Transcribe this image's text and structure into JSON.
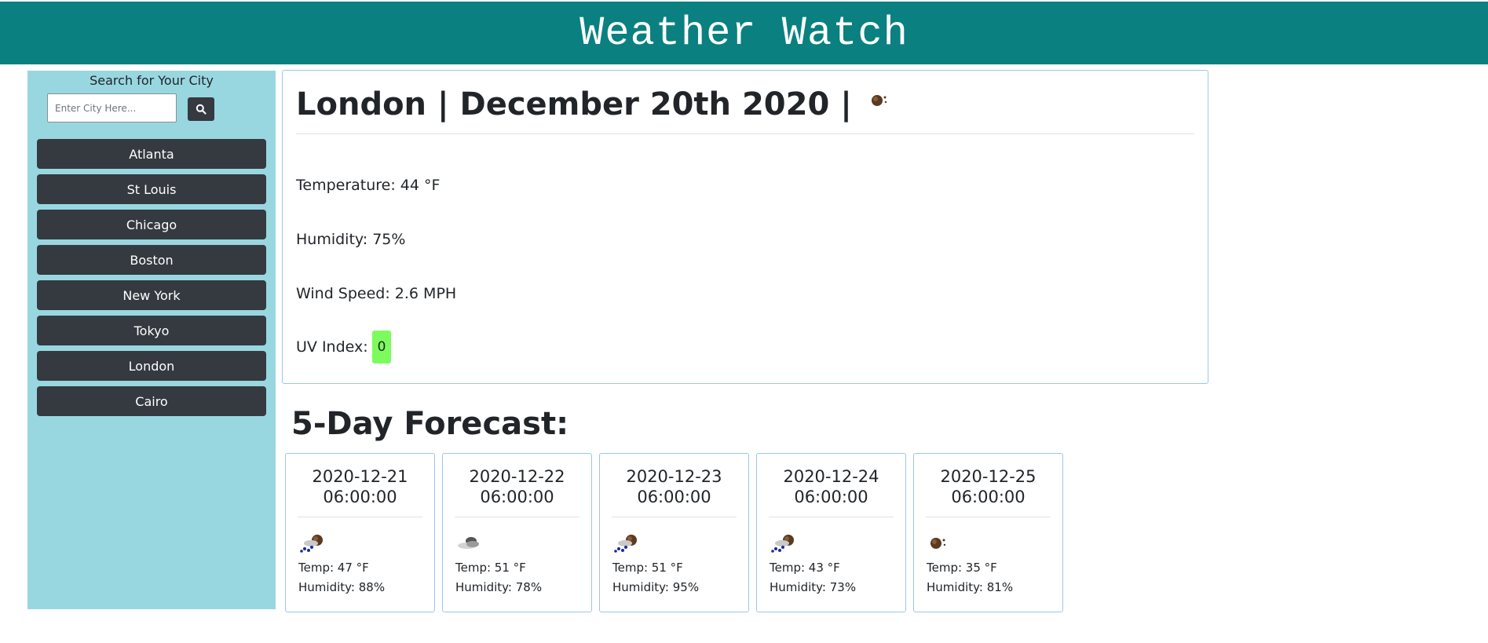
{
  "header": {
    "title": "Weather Watch"
  },
  "sidebar": {
    "search_label": "Search for Your City",
    "search_placeholder": "Enter City Here...",
    "cities": [
      "Atlanta",
      "St Louis",
      "Chicago",
      "Boston",
      "New York",
      "Tokyo",
      "London",
      "Cairo"
    ]
  },
  "current": {
    "title": "London | December 20th 2020 |",
    "icon": "clear-night-icon",
    "temperature": "Temperature: 44 °F",
    "humidity": "Humidity: 75%",
    "wind": "Wind Speed: 2.6 MPH",
    "uv_label": "UV Index:",
    "uv_value": "0",
    "uv_color": "#7cfc5c"
  },
  "forecast": {
    "title": "5-Day Forecast:",
    "days": [
      {
        "date": "2020-12-21",
        "time": "06:00:00",
        "icon": "rain-night-icon",
        "temp": "Temp: 47 °F",
        "humidity": "Humidity: 88%"
      },
      {
        "date": "2020-12-22",
        "time": "06:00:00",
        "icon": "cloud-icon",
        "temp": "Temp: 51 °F",
        "humidity": "Humidity: 78%"
      },
      {
        "date": "2020-12-23",
        "time": "06:00:00",
        "icon": "rain-night-icon",
        "temp": "Temp: 51 °F",
        "humidity": "Humidity: 95%"
      },
      {
        "date": "2020-12-24",
        "time": "06:00:00",
        "icon": "rain-night-icon",
        "temp": "Temp: 43 °F",
        "humidity": "Humidity: 73%"
      },
      {
        "date": "2020-12-25",
        "time": "06:00:00",
        "icon": "clear-night-icon",
        "temp": "Temp: 35 °F",
        "humidity": "Humidity: 81%"
      }
    ]
  },
  "colors": {
    "header": "#0a8080",
    "sidebar": "#98d7e0",
    "button": "#343a40",
    "card_border": "#9fc5e8"
  }
}
